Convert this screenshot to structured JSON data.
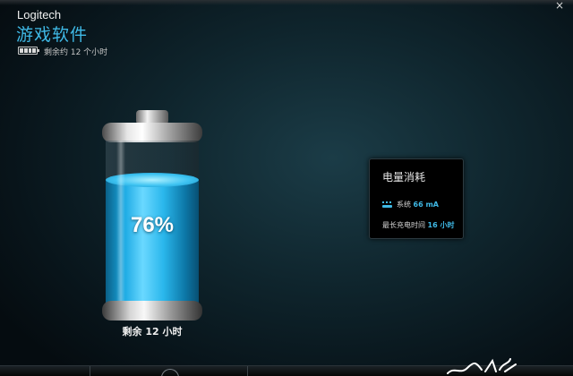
{
  "window": {
    "close_glyph": "×"
  },
  "header": {
    "brand": "Logitech",
    "title": "游戏软件",
    "battery_status": "剩余约 12 个小时"
  },
  "battery": {
    "percent_label": "76%",
    "level_percent": 76,
    "remaining_label": "剩余 12 小时",
    "liquid_color": "#1aa9e3"
  },
  "power_panel": {
    "title": "电量消耗",
    "system_label": "系统",
    "system_value": "66 mA",
    "max_charge_label": "最长充电时间",
    "max_charge_value": "16 小时",
    "accent_color": "#3fb9e6"
  },
  "icons": {
    "close": "close-icon",
    "mini_battery": "battery-icon",
    "system": "usb-device-icon"
  }
}
